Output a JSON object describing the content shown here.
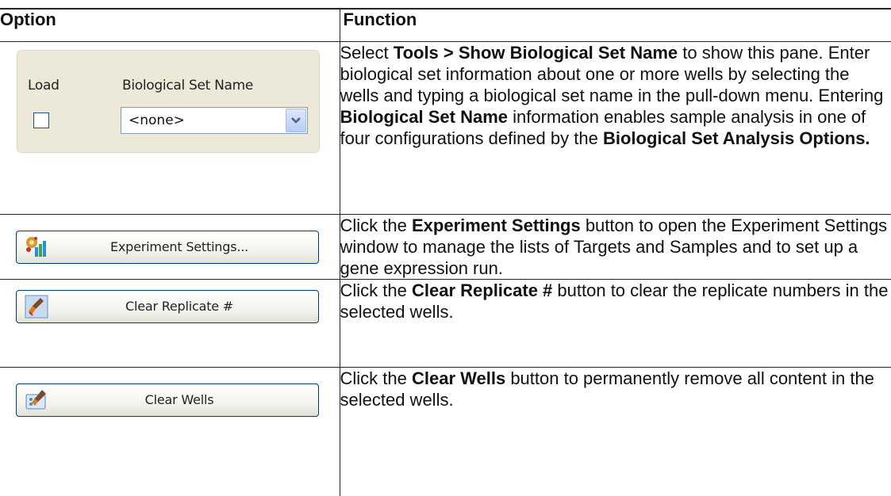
{
  "table": {
    "header_option": "Option",
    "header_function": "Function"
  },
  "rows": [
    {
      "option": {
        "load_label": "Load",
        "set_name_label": "Biological Set Name",
        "dropdown_value": "<none>"
      },
      "function": [
        {
          "t": "Select ",
          "b": false
        },
        {
          "t": "Tools > Show Biological Set Name",
          "b": true
        },
        {
          "t": " to show this pane. Enter biological set information about one or more wells by selecting the wells and typing a biological set name in the pull-down menu. Entering ",
          "b": false
        },
        {
          "t": "Biological Set Name",
          "b": true
        },
        {
          "t": " information enables sample analysis in one of four configurations defined by the ",
          "b": false
        },
        {
          "t": "Biological Set Analysis Options.",
          "b": true
        }
      ]
    },
    {
      "option": {
        "button_label": "Experiment Settings...",
        "icon": "experiment-settings-icon"
      },
      "function": [
        {
          "t": "Click the ",
          "b": false
        },
        {
          "t": "Experiment Settings",
          "b": true
        },
        {
          "t": " button to open the Experiment Settings window to manage the lists of Targets and Samples and to set up a gene expression run.",
          "b": false
        }
      ]
    },
    {
      "option": {
        "button_label": "Clear Replicate #",
        "icon": "clear-replicate-icon"
      },
      "function": [
        {
          "t": "Click the ",
          "b": false
        },
        {
          "t": "Clear Replicate #",
          "b": true
        },
        {
          "t": " button to clear the replicate numbers in the selected wells.",
          "b": false
        }
      ]
    },
    {
      "option": {
        "button_label": "Clear Wells",
        "icon": "clear-wells-icon"
      },
      "function": [
        {
          "t": "Click the ",
          "b": false
        },
        {
          "t": "Clear Wells",
          "b": true
        },
        {
          "t": " button to permanently remove all content in the selected wells.",
          "b": false
        }
      ]
    }
  ]
}
